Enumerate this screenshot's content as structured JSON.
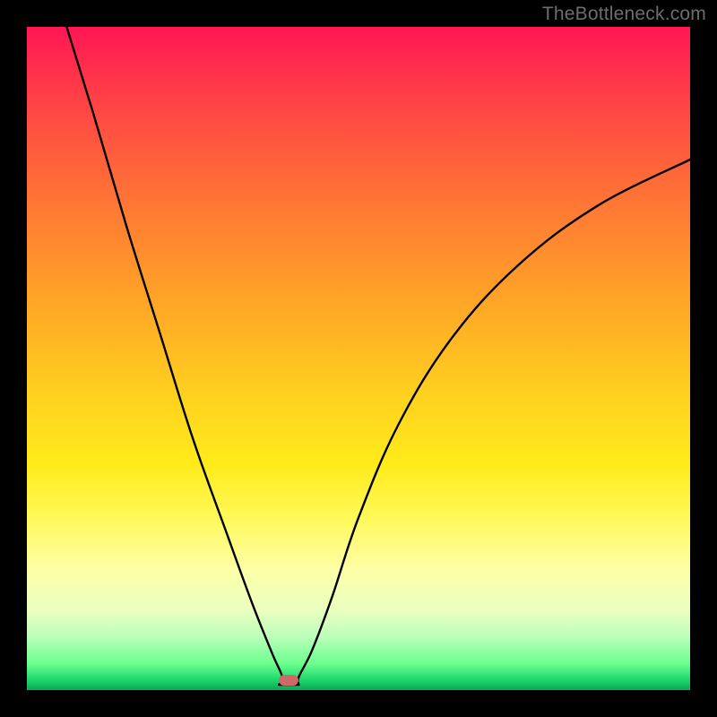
{
  "watermark": "TheBottleneck.com",
  "chart_data": {
    "type": "line",
    "title": "",
    "xlabel": "",
    "ylabel": "",
    "xlim": [
      0,
      1
    ],
    "ylim": [
      0,
      1
    ],
    "curve_min_x": 0.395,
    "marker": {
      "x": 0.395,
      "y": 0.985,
      "color": "#d06868"
    },
    "gradient_stops": [
      {
        "pos": 0.0,
        "color": "#ff1754"
      },
      {
        "pos": 0.12,
        "color": "#ff4545"
      },
      {
        "pos": 0.28,
        "color": "#ff7b33"
      },
      {
        "pos": 0.42,
        "color": "#ffa726"
      },
      {
        "pos": 0.56,
        "color": "#ffd21f"
      },
      {
        "pos": 0.66,
        "color": "#ffeb1a"
      },
      {
        "pos": 0.74,
        "color": "#fff95a"
      },
      {
        "pos": 0.82,
        "color": "#fdffa8"
      },
      {
        "pos": 0.88,
        "color": "#eaffc0"
      },
      {
        "pos": 0.92,
        "color": "#b9ffb9"
      },
      {
        "pos": 0.96,
        "color": "#6cff8f"
      },
      {
        "pos": 0.985,
        "color": "#1cd66a"
      },
      {
        "pos": 1.0,
        "color": "#0ca853"
      }
    ],
    "left_branch": [
      {
        "x": 0.06,
        "y": 1.0
      },
      {
        "x": 0.1,
        "y": 0.87
      },
      {
        "x": 0.15,
        "y": 0.7
      },
      {
        "x": 0.2,
        "y": 0.54
      },
      {
        "x": 0.25,
        "y": 0.38
      },
      {
        "x": 0.3,
        "y": 0.24
      },
      {
        "x": 0.34,
        "y": 0.13
      },
      {
        "x": 0.37,
        "y": 0.055
      },
      {
        "x": 0.385,
        "y": 0.02
      },
      {
        "x": 0.395,
        "y": 0.01
      }
    ],
    "right_branch": [
      {
        "x": 0.395,
        "y": 0.01
      },
      {
        "x": 0.41,
        "y": 0.02
      },
      {
        "x": 0.43,
        "y": 0.06
      },
      {
        "x": 0.46,
        "y": 0.14
      },
      {
        "x": 0.5,
        "y": 0.26
      },
      {
        "x": 0.56,
        "y": 0.4
      },
      {
        "x": 0.64,
        "y": 0.53
      },
      {
        "x": 0.74,
        "y": 0.64
      },
      {
        "x": 0.86,
        "y": 0.73
      },
      {
        "x": 1.0,
        "y": 0.8
      }
    ]
  }
}
